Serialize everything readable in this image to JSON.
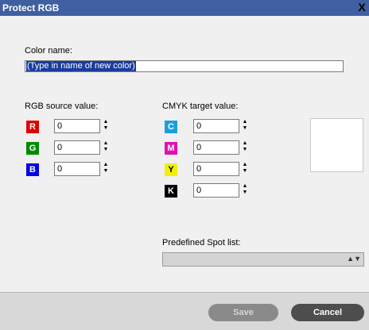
{
  "window": {
    "title": "Protect RGB",
    "close_glyph": "X"
  },
  "color_name": {
    "label": "Color name:",
    "value": "(Type in name of new color)"
  },
  "rgb": {
    "label": "RGB source value:",
    "channels": [
      {
        "letter": "R",
        "value": "0",
        "color": "#e00000"
      },
      {
        "letter": "G",
        "value": "0",
        "color": "#008a00"
      },
      {
        "letter": "B",
        "value": "0",
        "color": "#0000e0"
      }
    ]
  },
  "cmyk": {
    "label": "CMYK target value:",
    "channels": [
      {
        "letter": "C",
        "value": "0",
        "color": "#1a9ee0"
      },
      {
        "letter": "M",
        "value": "0",
        "color": "#e010b0"
      },
      {
        "letter": "Y",
        "value": "0",
        "color": "#f0f000"
      },
      {
        "letter": "K",
        "value": "0",
        "color": "#000000"
      }
    ]
  },
  "spot_list": {
    "label": "Predefined Spot list:",
    "selected": ""
  },
  "buttons": {
    "save": "Save",
    "cancel": "Cancel"
  },
  "icons": {
    "close": "close-icon",
    "spinner": "spinner-arrows-icon",
    "dropdown": "chevron-updown-icon"
  }
}
